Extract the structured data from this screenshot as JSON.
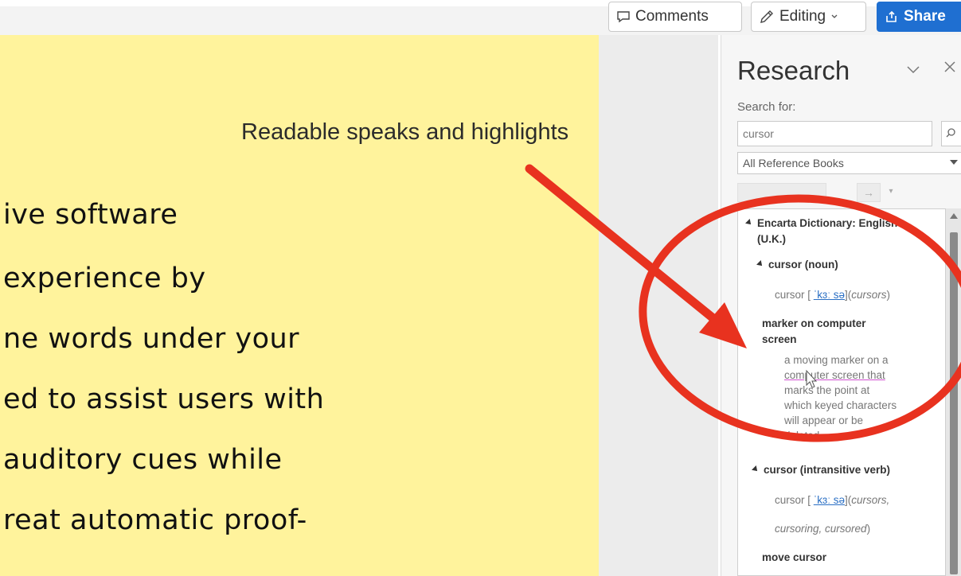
{
  "toolbar": {
    "comments_label": "Comments",
    "editing_label": "Editing",
    "share_label": "Share",
    "share_color": "#1f6fd1"
  },
  "document": {
    "background": "#fff39c",
    "lines": [
      "ive software",
      "experience by",
      "ne words under your",
      "ed to assist users with",
      "auditory cues while",
      "reat automatic proof-"
    ]
  },
  "annotation": {
    "text": "Readable speaks and highlights",
    "color": "#e8321f",
    "shapes": [
      "red-arrow",
      "red-circle"
    ]
  },
  "research": {
    "title": "Research",
    "search_label": "Search for:",
    "search_value": "cursor",
    "reference_select": "All Reference Books",
    "results": {
      "dictionary": "Encarta Dictionary: English (U.K.)",
      "dictionary_line1": "Encarta Dictionary: English",
      "dictionary_line2": "(U.K.)",
      "entry1_head": "cursor (noun)",
      "entry1_word": "cursor [",
      "entry1_pron": "ˈkɜː sə",
      "entry1_close": "](",
      "entry1_forms": "cursors",
      "entry1_end": ")",
      "sense1_heading_line1": "marker on computer",
      "sense1_heading_line2": "screen",
      "sense1_def_lines": [
        "a moving marker on a",
        "computer screen that",
        "marks the point at",
        "which keyed characters",
        "will appear or be",
        "deleted"
      ],
      "entry2_head": "cursor (intransitive verb)",
      "entry2_word": "cursor [",
      "entry2_pron": "ˈkɜː sə",
      "entry2_close": "](",
      "entry2_forms1": "cursors,",
      "entry2_forms2": "cursoring, cursored",
      "entry2_end": ")",
      "sense2_heading": "move cursor"
    }
  }
}
